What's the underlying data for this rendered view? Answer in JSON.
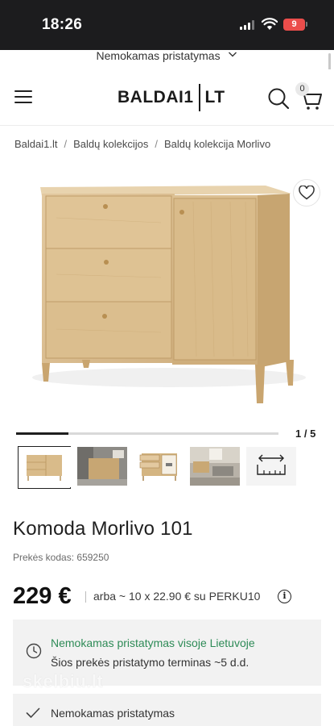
{
  "status_bar": {
    "time": "18:26",
    "battery": "9",
    "colors": {
      "battery": "#eb4d4b"
    }
  },
  "promo": {
    "text": "Nemokamas pristatymas"
  },
  "header": {
    "logo_left": "BALDAI1",
    "logo_right": "LT",
    "cart_count": "0"
  },
  "breadcrumb": [
    "Baldai1.lt",
    "Baldų kolekcijos",
    "Baldų kolekcija Morlivo"
  ],
  "gallery": {
    "counter": "1 / 5",
    "progress": 0.2,
    "thumbnail_count": 5
  },
  "product": {
    "title": "Komoda Morlivo 101",
    "sku_label": "Prekės kodas:",
    "sku_value": "659250",
    "price": "229 €",
    "installment": "arba ~ 10 x 22.90 € su PERKU10",
    "info_symbol": "i"
  },
  "delivery": {
    "title": "Nemokamas pristatymas visoje Lietuvoje",
    "subtitle": "Šios prekės pristatymo terminas ~5 d.d.",
    "colors": {
      "title": "#2e8b57"
    }
  },
  "watermark": "skelbiu.lt",
  "features": [
    {
      "text": "Nemokamas pristatymas"
    }
  ]
}
